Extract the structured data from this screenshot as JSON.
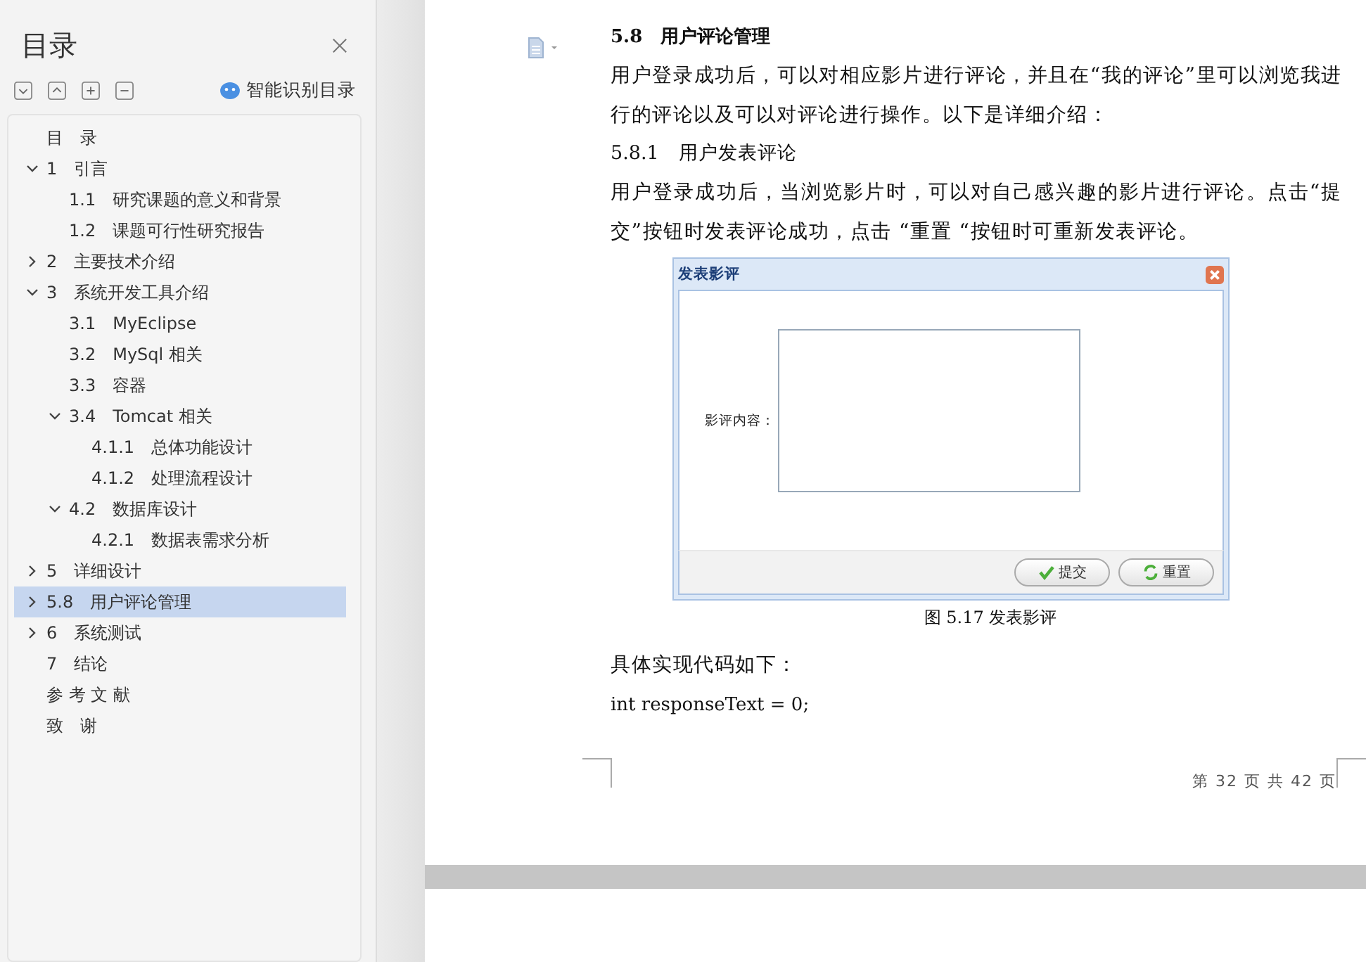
{
  "sidebar": {
    "title": "目录",
    "smart_button": "智能识别目录",
    "toc": [
      {
        "label": "目　录",
        "selected": false
      },
      {
        "label": "1　引言",
        "expanded": true,
        "selected": false,
        "children": [
          {
            "label": "1.1　研究课题的意义和背景",
            "selected": false
          },
          {
            "label": "1.2　课题可行性研究报告",
            "selected": false
          }
        ]
      },
      {
        "label": "2　主要技术介绍",
        "expanded": false,
        "selected": false
      },
      {
        "label": "3　系统开发工具介绍",
        "expanded": true,
        "selected": false,
        "children": [
          {
            "label": "3.1　MyEclipse",
            "selected": false
          },
          {
            "label": "3.2　MySql 相关",
            "selected": false
          },
          {
            "label": "3.3　容器",
            "selected": false
          },
          {
            "label": "3.4　Tomcat 相关",
            "expanded": true,
            "selected": false,
            "children": [
              {
                "label": "4.1.1　总体功能设计",
                "selected": false
              },
              {
                "label": "4.1.2　处理流程设计",
                "selected": false
              }
            ]
          },
          {
            "label": "4.2　数据库设计",
            "expanded": true,
            "selected": false,
            "children": [
              {
                "label": "4.2.1　数据表需求分析",
                "selected": false
              }
            ]
          }
        ]
      },
      {
        "label": "5　详细设计",
        "expanded": false,
        "selected": false
      },
      {
        "label": "5.8　用户评论管理",
        "expanded": false,
        "selected": true
      },
      {
        "label": "6　系统测试",
        "expanded": false,
        "selected": false
      },
      {
        "label": "7　结论",
        "selected": false
      },
      {
        "label": "参 考 文 献",
        "selected": false
      },
      {
        "label": "致　谢",
        "selected": false
      }
    ]
  },
  "document": {
    "heading": "5.8　用户评论管理",
    "paragraph_1": "用户登录成功后，可以对相应影片进行评论，并且在“我的评论”里可以浏览我进行的评论以及可以对评论进行操作。以下是详细介绍：",
    "subheading": "5.8.1　用户发表评论",
    "paragraph_2": "用户登录成功后，当浏览影片时，可以对自己感兴趣的影片进行评论。点击“提交”按钮时发表评论成功，点击 “重置 “按钮时可重新发表评论。",
    "figure": {
      "dialog_title": "发表影评",
      "field_label": "影评内容：",
      "buttons": [
        {
          "kind": "submit",
          "label": "提交"
        },
        {
          "kind": "reset",
          "label": "重置"
        }
      ]
    },
    "caption": "图 5.17  发表影评",
    "paragraph_3": "具体实现代码如下：",
    "code_line": "int responseText = 0;",
    "footer": "第 32 页 共 42 页"
  }
}
